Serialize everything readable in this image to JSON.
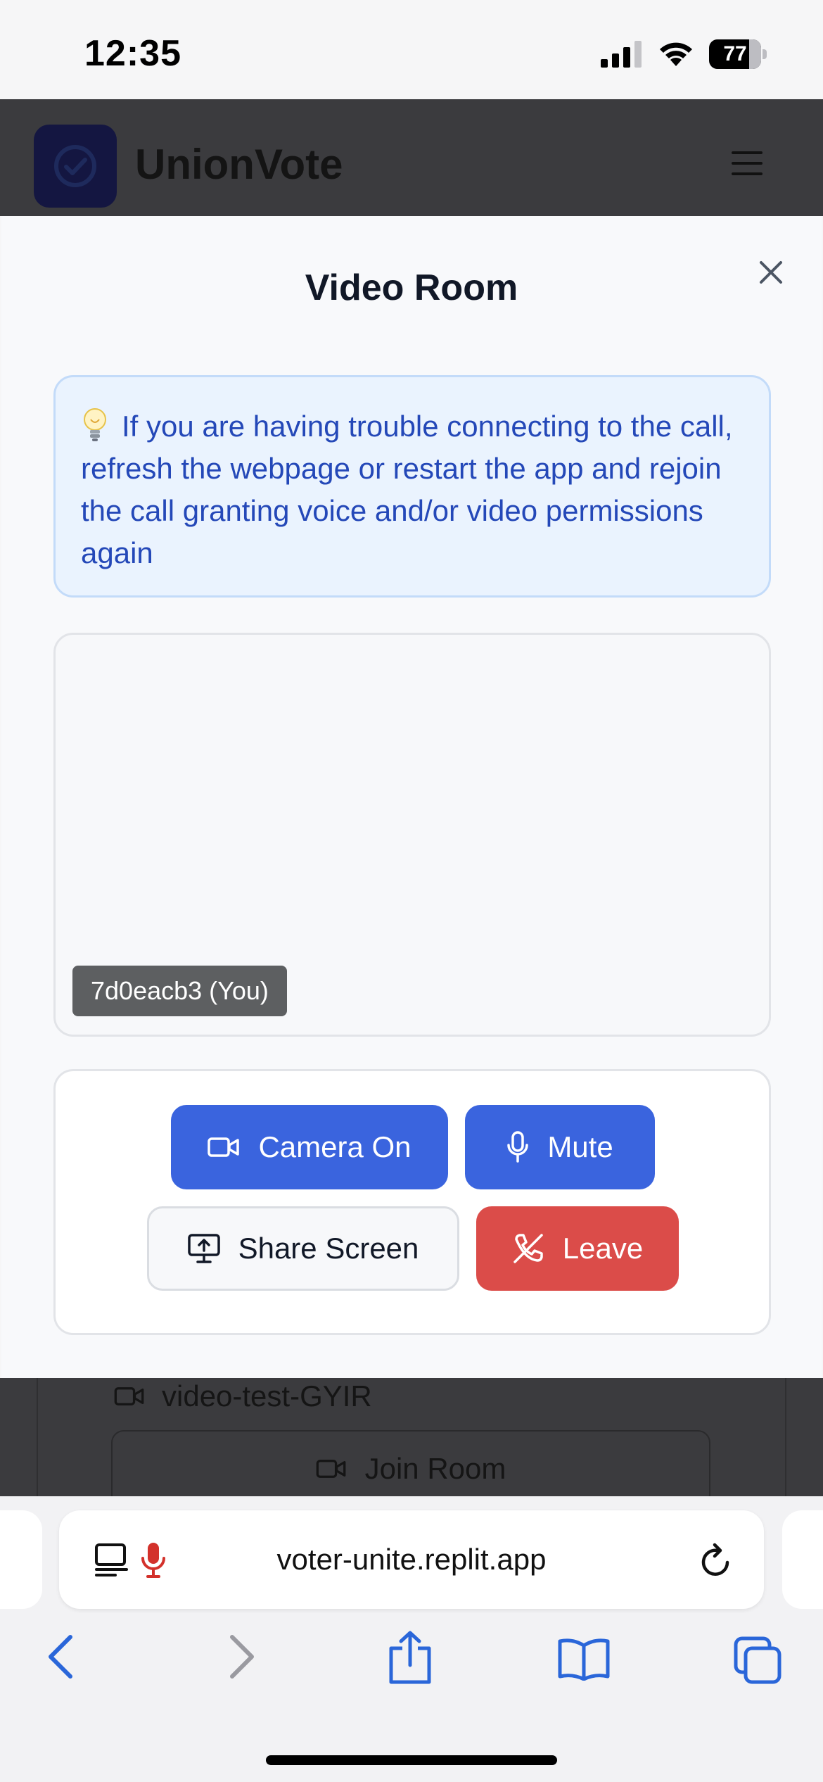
{
  "status_bar": {
    "time": "12:35",
    "battery_level": "77",
    "signal_bars_active": 3
  },
  "app_header": {
    "title": "UnionVote",
    "logo_icon": "check-circle-icon",
    "menu_icon": "hamburger-icon"
  },
  "modal": {
    "title": "Video Room",
    "close_icon": "close-icon",
    "notice": {
      "icon": "lightbulb-icon",
      "text": "If you are having trouble connecting to the call, refresh the webpage or restart the app and rejoin the call granting voice and/or video permissions again"
    },
    "participant": {
      "name_tag": "7d0eacb3 (You)"
    },
    "controls": {
      "camera_label": "Camera On",
      "mute_label": "Mute",
      "share_label": "Share Screen",
      "leave_label": "Leave"
    }
  },
  "background_content": {
    "room_name": "video-test-GYIR",
    "join_label": "Join Room"
  },
  "browser": {
    "url": "voter-unite.replit.app"
  },
  "colors": {
    "primary": "#3a64de",
    "danger": "#db4c49",
    "notice_bg": "#eaf3fe",
    "notice_text": "#2448b8",
    "overlay": "#3b3b3e",
    "browser_accent": "#2a66d9",
    "mic_active": "#d3312b"
  }
}
